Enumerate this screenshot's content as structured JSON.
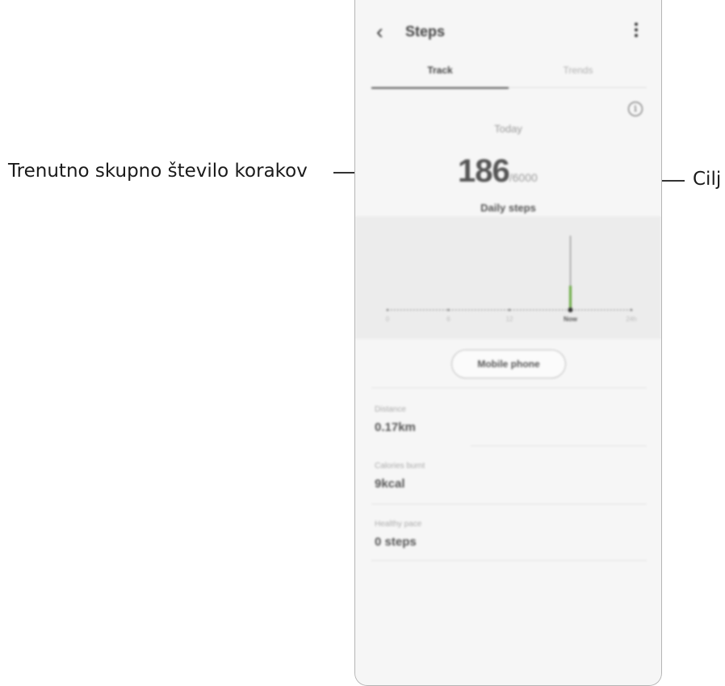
{
  "callouts": {
    "left": "Trenutno skupno število korakov",
    "right": "Cilj"
  },
  "appbar": {
    "title": "Steps",
    "back_icon": "chevron-left-icon",
    "more_icon": "more-vert-icon"
  },
  "tabs": [
    {
      "label": "Track",
      "active": true
    },
    {
      "label": "Trends",
      "active": false
    }
  ],
  "summary": {
    "period": "Today",
    "steps": "186",
    "goal": "/6000",
    "caption": "Daily steps"
  },
  "chart_data": {
    "type": "bar",
    "x_ticks": [
      "0",
      "6",
      "12",
      "Now",
      "24h"
    ],
    "bars": [
      {
        "label": "Now",
        "value": 186
      }
    ],
    "accent": "#6aab42"
  },
  "device_button": "Mobile phone",
  "stats": [
    {
      "label": "Distance",
      "value": "0.17km"
    },
    {
      "label": "Calories burnt",
      "value": "9kcal"
    },
    {
      "label": "Healthy pace",
      "value": "0 steps"
    }
  ]
}
